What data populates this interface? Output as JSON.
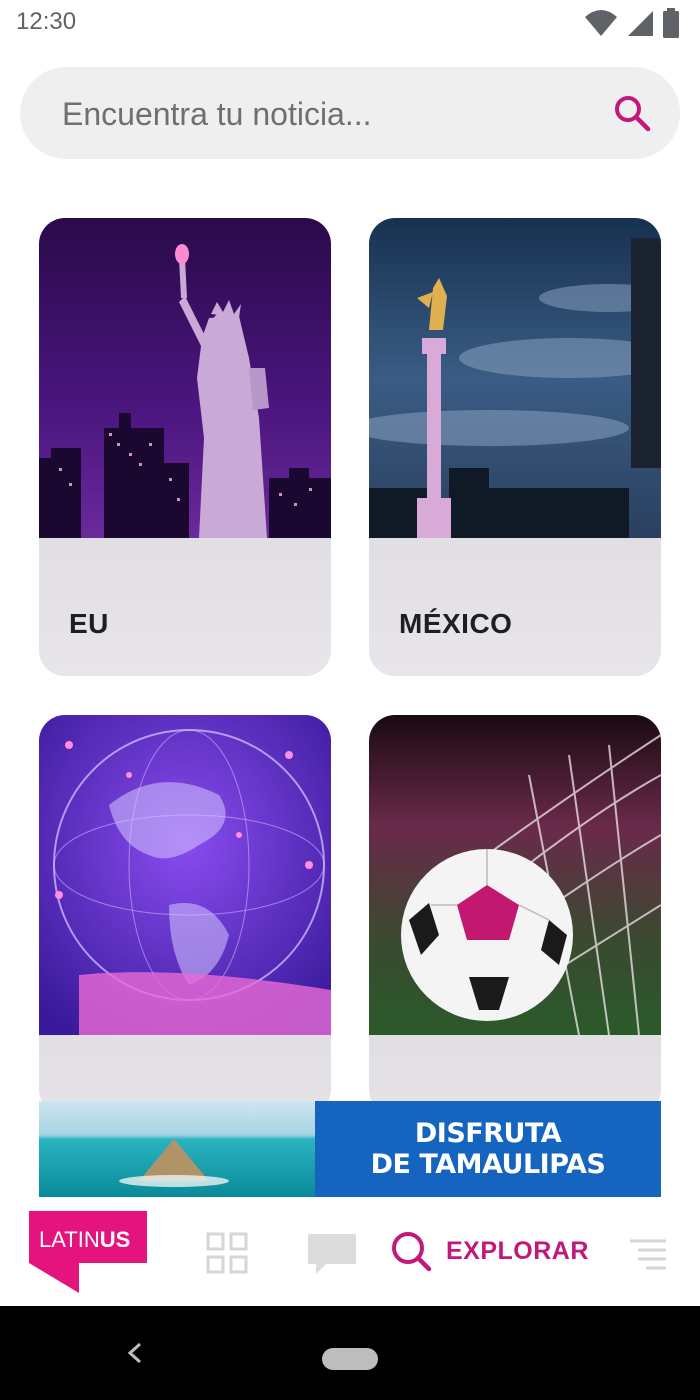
{
  "status_bar": {
    "time": "12:30"
  },
  "search": {
    "placeholder": "Encuentra tu noticia..."
  },
  "categories": [
    {
      "label": "EU"
    },
    {
      "label": "MÉXICO"
    },
    {
      "label": ""
    },
    {
      "label": ""
    }
  ],
  "ad": {
    "line1": "DISFRUTA",
    "line2": "DE TAMAULIPAS"
  },
  "bottom_nav": {
    "logo_text_light": "LATIN",
    "logo_text_bold": "US",
    "explore_label": "EXPLORAR",
    "icons": [
      "grid-icon",
      "chat-icon",
      "search-icon",
      "menu-icon"
    ]
  },
  "colors": {
    "accent": "#c2187a",
    "ad_blue": "#1565c0",
    "logo_magenta": "#e5137d"
  }
}
